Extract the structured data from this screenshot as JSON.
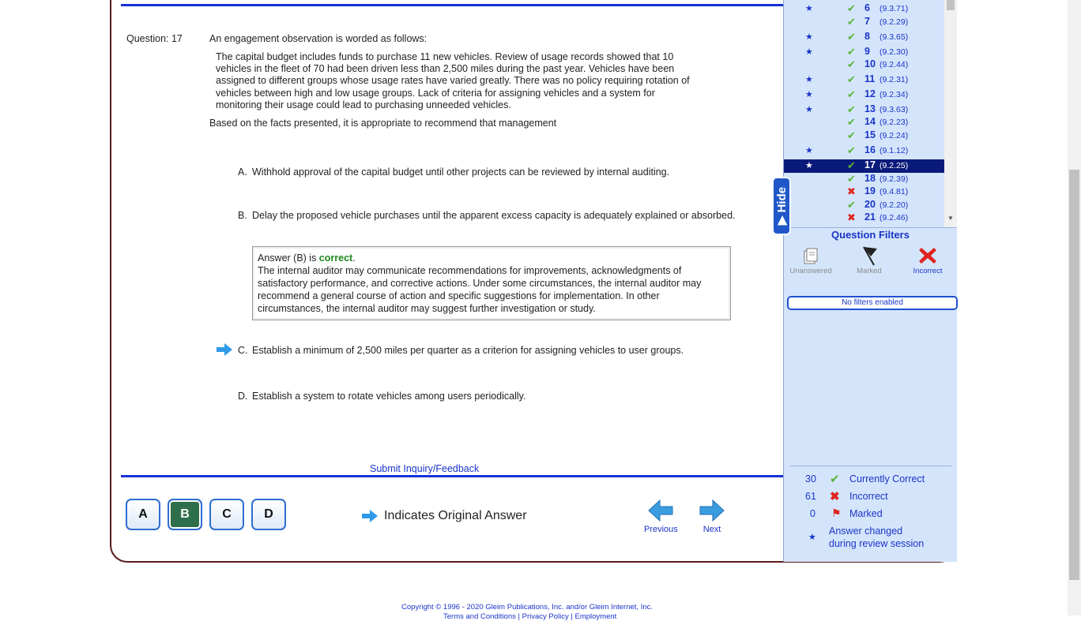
{
  "question": {
    "number_label": "Question: 17",
    "intro": "An engagement observation is worded as follows:",
    "scenario": "The capital budget includes funds to purchase 11 new vehicles. Review of usage records showed that 10 vehicles in the fleet of 70 had been driven less than 2,500 miles during the past year. Vehicles have been assigned to different groups whose usage rates have varied greatly. There was no policy requiring rotation of vehicles between high and low usage groups. Lack of criteria for assigning vehicles and a system for monitoring their usage could lead to purchasing unneeded vehicles.",
    "stem": "Based on the facts presented, it is appropriate to recommend that management",
    "choices": [
      {
        "letter": "A.",
        "text": "Withhold approval of the capital budget until other projects can be reviewed by internal auditing."
      },
      {
        "letter": "B.",
        "text": "Delay the proposed vehicle purchases until the apparent excess capacity is adequately explained or absorbed."
      },
      {
        "letter": "C.",
        "text": "Establish a minimum of 2,500 miles per quarter as a criterion for assigning vehicles to user groups."
      },
      {
        "letter": "D.",
        "text": "Establish a system to rotate vehicles among users periodically."
      }
    ],
    "explanation": {
      "prefix": "Answer (B) is ",
      "verdict": "correct",
      "suffix": ".",
      "body": "The internal auditor may communicate recommendations for improvements, acknowledgments of satisfactory performance, and corrective actions. Under some circumstances, the internal auditor may recommend a general course of action and specific suggestions for implementation. In other circumstances, the internal auditor may suggest further investigation or study."
    }
  },
  "submit_link": "Submit Inquiry/Feedback",
  "answer_buttons": [
    "A",
    "B",
    "C",
    "D"
  ],
  "selected_answer": "B",
  "original_answer_legend": "Indicates Original Answer",
  "nav": {
    "previous": "Previous",
    "next": "Next"
  },
  "question_list": [
    {
      "num": "6",
      "ref": "(9.3.71)",
      "status": "correct",
      "star": true
    },
    {
      "num": "7",
      "ref": "(9.2.29)",
      "status": "correct",
      "star": false
    },
    {
      "num": "8",
      "ref": "(9.3.65)",
      "status": "correct",
      "star": true
    },
    {
      "num": "9",
      "ref": "(9.2.30)",
      "status": "correct",
      "star": true
    },
    {
      "num": "10",
      "ref": "(9.2.44)",
      "status": "correct",
      "star": false
    },
    {
      "num": "11",
      "ref": "(9.2.31)",
      "status": "correct",
      "star": true
    },
    {
      "num": "12",
      "ref": "(9.2.34)",
      "status": "correct",
      "star": true
    },
    {
      "num": "13",
      "ref": "(9.3.63)",
      "status": "correct",
      "star": true
    },
    {
      "num": "14",
      "ref": "(9.2.23)",
      "status": "correct",
      "star": false
    },
    {
      "num": "15",
      "ref": "(9.2.24)",
      "status": "correct",
      "star": false
    },
    {
      "num": "16",
      "ref": "(9.1.12)",
      "status": "correct",
      "star": true
    },
    {
      "num": "17",
      "ref": "(9.2.25)",
      "status": "correct",
      "star": true,
      "active": true
    },
    {
      "num": "18",
      "ref": "(9.2.39)",
      "status": "correct",
      "star": false
    },
    {
      "num": "19",
      "ref": "(9.4.81)",
      "status": "incorrect",
      "star": false
    },
    {
      "num": "20",
      "ref": "(9.2.20)",
      "status": "correct",
      "star": false
    },
    {
      "num": "21",
      "ref": "(9.2.46)",
      "status": "incorrect",
      "star": false
    }
  ],
  "hide_tab": "Hide",
  "filters": {
    "title": "Question Filters",
    "items": [
      "Unanswered",
      "Marked",
      "Incorrect"
    ],
    "status": "No filters enabled"
  },
  "stats": {
    "correct_count": "30",
    "correct_label": "Currently Correct",
    "incorrect_count": "61",
    "incorrect_label": "Incorrect",
    "marked_count": "0",
    "marked_label": "Marked",
    "changed_label_1": "Answer changed",
    "changed_label_2": "during review session"
  },
  "footer": {
    "copyright": "Copyright © 1996 - 2020 Gleim Publications, Inc. and/or Gleim Internet, Inc.",
    "links": "Terms and Conditions | Privacy Policy | Employment"
  },
  "colors": {
    "accent": "#1530d8",
    "sidebar": "#d4e5fb",
    "correct": "#5ab43a",
    "incorrect": "#e0241f",
    "selected_button": "#2f6e4a"
  }
}
